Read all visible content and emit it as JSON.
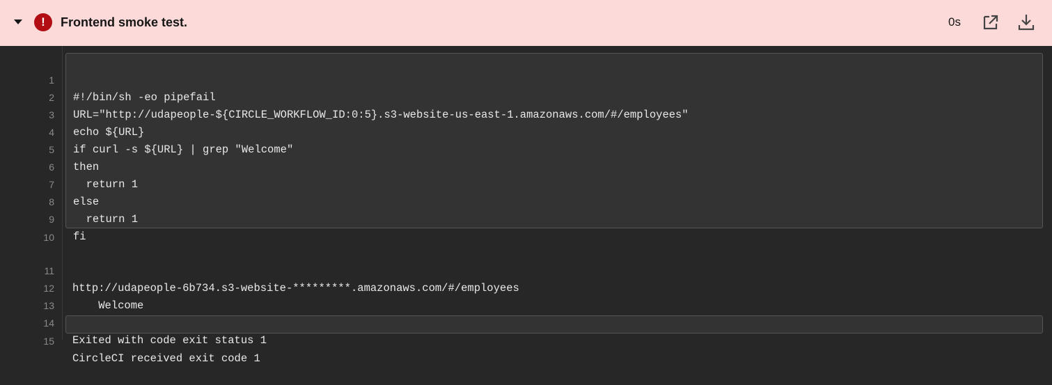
{
  "step": {
    "title": "Frontend smoke test.",
    "status": "failed",
    "duration": "0s",
    "icons": {
      "collapse": "chevron-down-icon",
      "status": "error-icon",
      "open": "open-external-icon",
      "download": "download-icon"
    },
    "colors": {
      "header_bg": "#fcdada",
      "error": "#b20d13"
    }
  },
  "command_lines": [
    {
      "n": "1",
      "text": "#!/bin/sh -eo pipefail"
    },
    {
      "n": "2",
      "text": "URL=\"http://udapeople-${CIRCLE_WORKFLOW_ID:0:5}.s3-website-us-east-1.amazonaws.com/#/employees\""
    },
    {
      "n": "3",
      "text": "echo ${URL}"
    },
    {
      "n": "4",
      "text": "if curl -s ${URL} | grep \"Welcome\""
    },
    {
      "n": "5",
      "text": "then"
    },
    {
      "n": "6",
      "text": "  return 1"
    },
    {
      "n": "7",
      "text": "else"
    },
    {
      "n": "8",
      "text": "  return 1"
    },
    {
      "n": "9",
      "text": "fi"
    },
    {
      "n": "10",
      "text": ""
    }
  ],
  "output_lines": [
    {
      "n": "11",
      "text": "http://udapeople-6b734.s3-website-*********.amazonaws.com/#/employees"
    },
    {
      "n": "12",
      "text": "    Welcome"
    },
    {
      "n": "13",
      "text": ""
    },
    {
      "n": "14",
      "text": "Exited with code exit status 1"
    },
    {
      "n": "15",
      "text": "CircleCI received exit code 1"
    }
  ]
}
